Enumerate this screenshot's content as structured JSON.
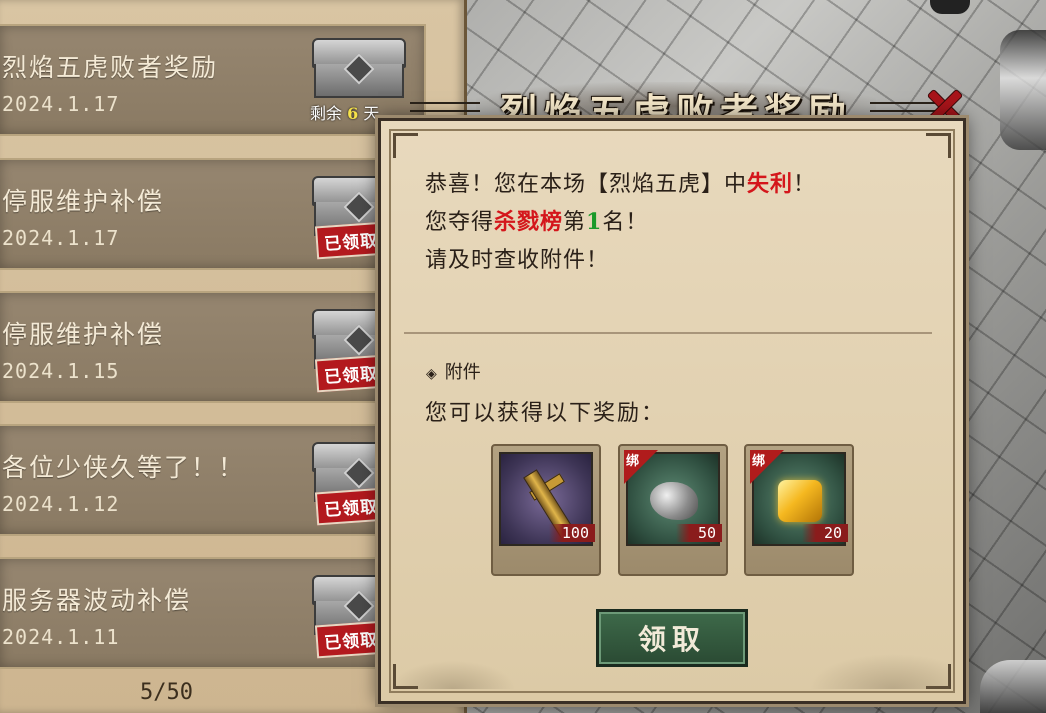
{
  "mail_list": {
    "items": [
      {
        "title": "烈焰五虎败者奖励",
        "date": "2024.1.17",
        "remaining_label": "剩余",
        "remaining_count": "6",
        "remaining_suffix": "天"
      },
      {
        "title": "停服维护补偿",
        "date": "2024.1.17",
        "status": "已领取"
      },
      {
        "title": "停服维护补偿",
        "date": "2024.1.15",
        "status": "已领取"
      },
      {
        "title": "各位少侠久等了！！",
        "date": "2024.1.12",
        "status": "已领取"
      },
      {
        "title": "服务器波动补偿",
        "date": "2024.1.11",
        "status": "已领取"
      }
    ],
    "page_indicator": "5/50"
  },
  "dialog": {
    "title": "烈焰五虎败者奖励",
    "line1_prefix": "恭喜！您在本场【烈焰五虎】中",
    "line1_highlight": "失利",
    "line1_suffix": "！",
    "line2_prefix": "您夺得",
    "line2_highlight": "杀戮榜",
    "line2_mid": "第",
    "line2_rank": "1",
    "line2_suffix": "名！",
    "line3": "请及时查收附件！",
    "attachment_label": "附件",
    "attachment_sub": "您可以获得以下奖励：",
    "rewards": [
      {
        "icon": "sword-icon",
        "quantity": "100",
        "bound": false
      },
      {
        "icon": "ore-icon",
        "quantity": "50",
        "bound": true,
        "bound_label": "绑"
      },
      {
        "icon": "gold-ingot-icon",
        "quantity": "20",
        "bound": true,
        "bound_label": "绑"
      }
    ],
    "claim_button": "领取"
  },
  "colors": {
    "highlight_red": "#d4161b",
    "highlight_green": "#1a9a2a",
    "claimed_stamp": "#b3191e",
    "claim_button": "#2f5a3b"
  }
}
